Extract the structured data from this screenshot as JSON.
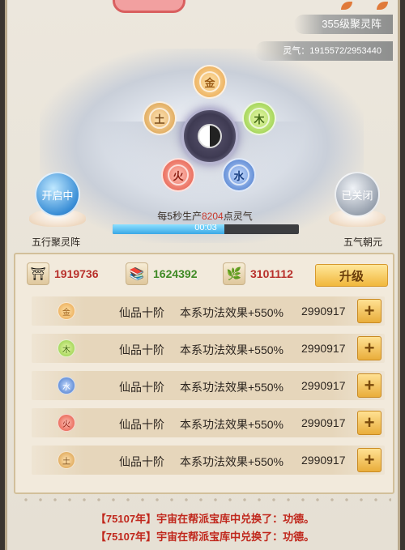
{
  "header": {
    "level_badge": "355级聚灵阵",
    "qi_badge": "灵气：1915572/2953440"
  },
  "array": {
    "center": "☯",
    "elements": {
      "jin": "金",
      "mu": "木",
      "tu": "土",
      "huo": "火",
      "shui": "水"
    },
    "left_orb": "开启中",
    "left_label": "五行聚灵阵",
    "right_orb": "已关闭",
    "right_label": "五气朝元"
  },
  "production": {
    "prefix": "每5秒生产",
    "amount": "8204",
    "suffix": "点灵气",
    "timer": "00:03",
    "progress": 0.6
  },
  "resources": [
    {
      "icon": "jade-seal-icon",
      "glyph": "⛩",
      "value": "1919736",
      "color": "#b8302b"
    },
    {
      "icon": "book-stack-icon",
      "glyph": "📚",
      "value": "1624392",
      "color": "#3f8a25"
    },
    {
      "icon": "herb-icon",
      "glyph": "🌿",
      "value": "3101112",
      "color": "#b8302b"
    }
  ],
  "upgrade_label": "升级",
  "rows": [
    {
      "element": "金",
      "grade": "仙品十阶",
      "effect": "本系功法效果+550%",
      "value": "2990917",
      "plus": "+"
    },
    {
      "element": "木",
      "grade": "仙品十阶",
      "effect": "本系功法效果+550%",
      "value": "2990917",
      "plus": "+"
    },
    {
      "element": "水",
      "grade": "仙品十阶",
      "effect": "本系功法效果+550%",
      "value": "2990917",
      "plus": "+"
    },
    {
      "element": "火",
      "grade": "仙品十阶",
      "effect": "本系功法效果+550%",
      "value": "2990917",
      "plus": "+"
    },
    {
      "element": "土",
      "grade": "仙品十阶",
      "effect": "本系功法效果+550%",
      "value": "2990917",
      "plus": "+"
    }
  ],
  "logs": [
    {
      "year": "【75107年】",
      "text": "宇宙在帮派宝库中兑换了：",
      "item": "功德。"
    },
    {
      "year": "【75107年】",
      "text": "宇宙在帮派宝库中兑换了：",
      "item": "功德。"
    }
  ]
}
